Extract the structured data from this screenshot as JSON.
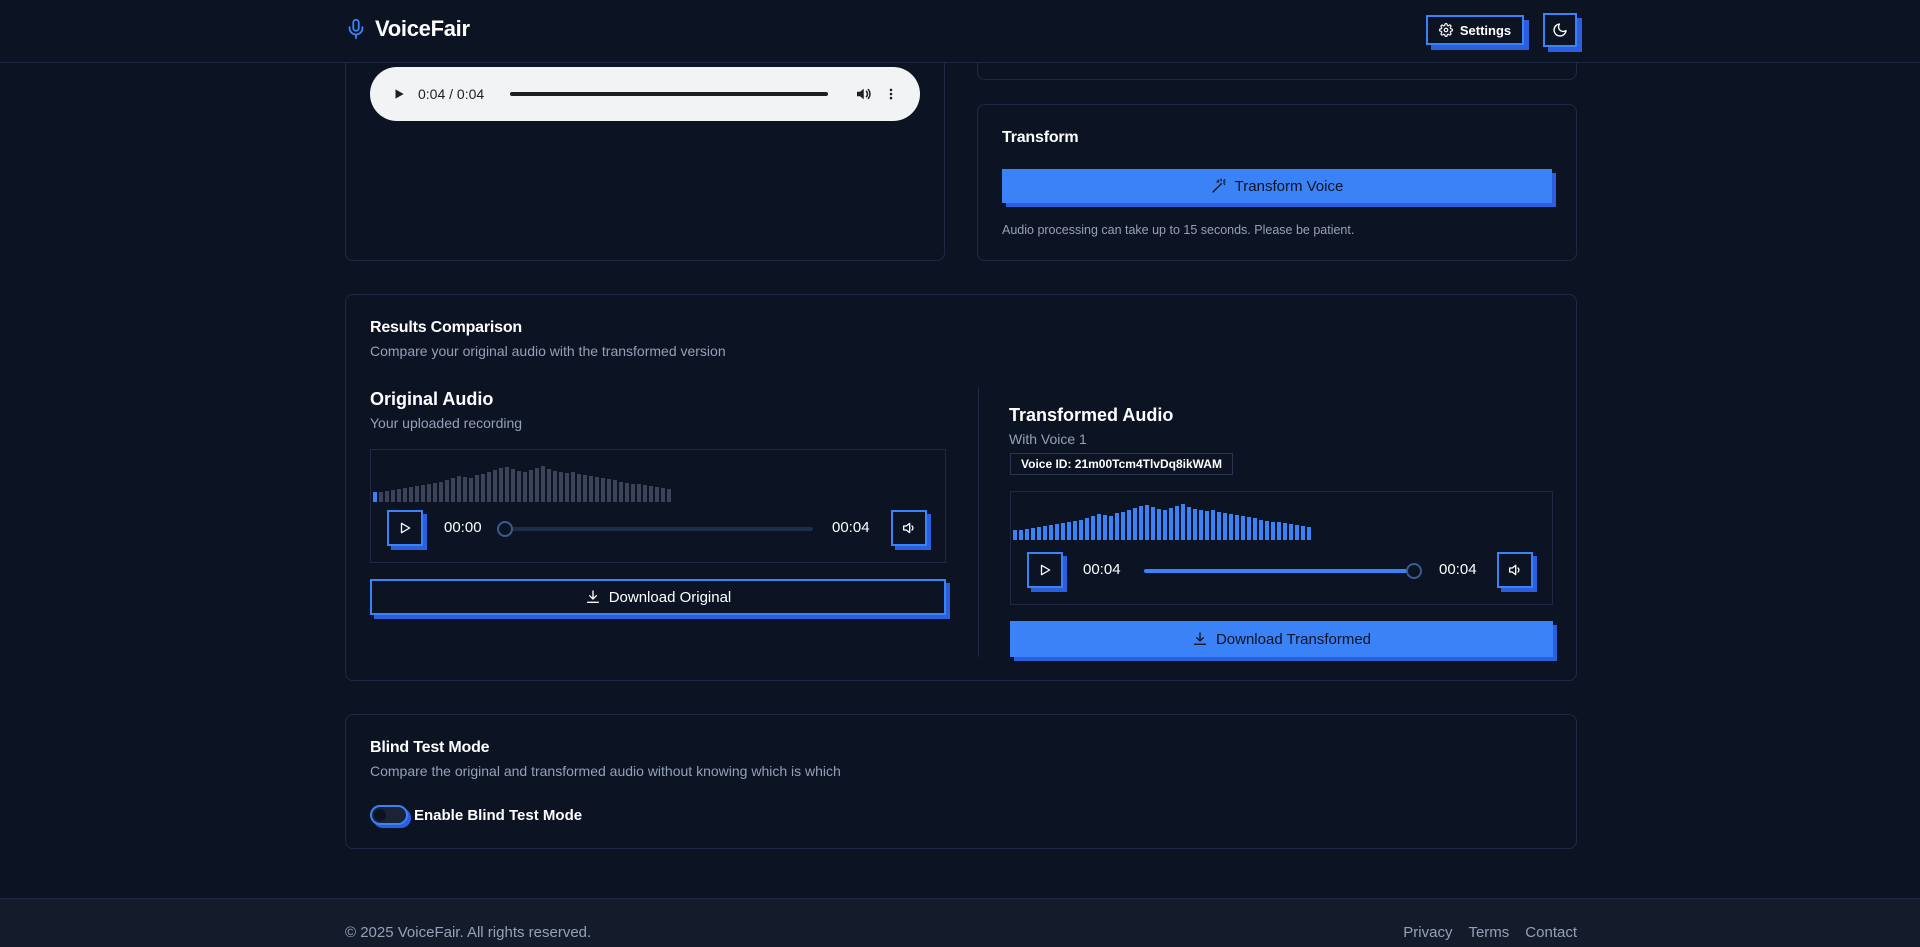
{
  "app": {
    "name": "VoiceFair"
  },
  "header": {
    "settings_label": "Settings"
  },
  "top_player": {
    "time": "0:04 / 0:04"
  },
  "transform": {
    "title": "Transform",
    "button_label": "Transform Voice",
    "note": "Audio processing can take up to 15 seconds. Please be patient."
  },
  "results": {
    "title": "Results Comparison",
    "subtitle": "Compare your original audio with the transformed version",
    "original": {
      "title": "Original Audio",
      "subtitle": "Your uploaded recording",
      "current_time": "00:00",
      "duration": "00:04",
      "progress": 0.0,
      "download_label": "Download Original"
    },
    "transformed": {
      "title": "Transformed Audio",
      "subtitle": "With Voice 1",
      "voice_id_label": "Voice ID: 21m00Tcm4TlvDq8ikWAM",
      "current_time": "00:04",
      "duration": "00:04",
      "progress": 1.0,
      "download_label": "Download Transformed"
    }
  },
  "blind_test": {
    "title": "Blind Test Mode",
    "subtitle": "Compare the original and transformed audio without knowing which is which",
    "toggle_label": "Enable Blind Test Mode",
    "enabled": false
  },
  "footer": {
    "copyright": "© 2025 VoiceFair. All rights reserved.",
    "links": [
      "Privacy",
      "Terms",
      "Contact"
    ]
  },
  "colors": {
    "accent": "#3b82f6",
    "accent_shadow": "#2b5fe0",
    "background": "#0c1424",
    "wave_original": "#3a4357",
    "wave_transformed": "#3b82f6"
  },
  "waveform": {
    "original": [
      10,
      10,
      11,
      12,
      13,
      14,
      15,
      16,
      17,
      18,
      19,
      20,
      22,
      24,
      26,
      25,
      24,
      27,
      28,
      30,
      32,
      34,
      35,
      33,
      31,
      30,
      32,
      34,
      36,
      33,
      31,
      30,
      29,
      30,
      28,
      27,
      26,
      25,
      24,
      23,
      22,
      20,
      19,
      18,
      18,
      17,
      16,
      15,
      14,
      13
    ],
    "transformed": [
      10,
      10,
      11,
      12,
      13,
      14,
      15,
      16,
      17,
      18,
      19,
      20,
      22,
      24,
      26,
      25,
      24,
      27,
      28,
      30,
      32,
      34,
      35,
      33,
      31,
      30,
      32,
      34,
      36,
      33,
      31,
      30,
      29,
      30,
      28,
      27,
      26,
      25,
      24,
      23,
      22,
      20,
      19,
      18,
      18,
      17,
      16,
      15,
      14,
      13
    ]
  }
}
